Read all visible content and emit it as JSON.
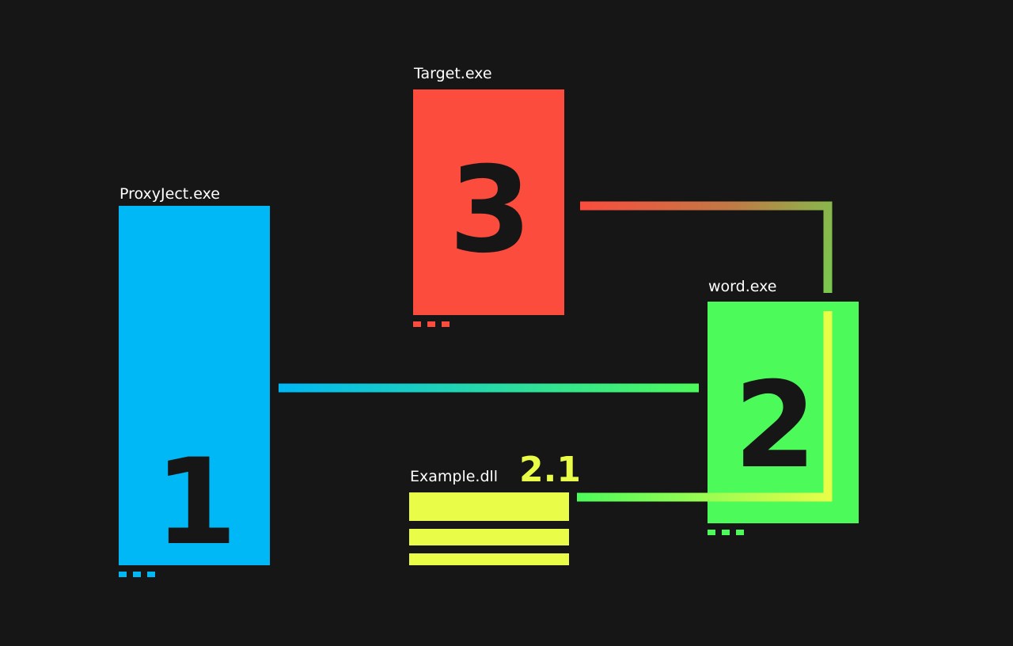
{
  "colors": {
    "background": "#161616",
    "process1": "#00b8f5",
    "process2": "#4cfa5a",
    "process3": "#fb4c3e",
    "dll": "#e9fd48",
    "label_text": "#ffffff",
    "number_text": "#161616"
  },
  "nodes": {
    "proxyject": {
      "label": "ProxyJect.exe",
      "number": "1"
    },
    "word": {
      "label": "word.exe",
      "number": "2"
    },
    "target": {
      "label": "Target.exe",
      "number": "3"
    },
    "dll": {
      "label": "Example.dll",
      "number": "2.1"
    }
  }
}
